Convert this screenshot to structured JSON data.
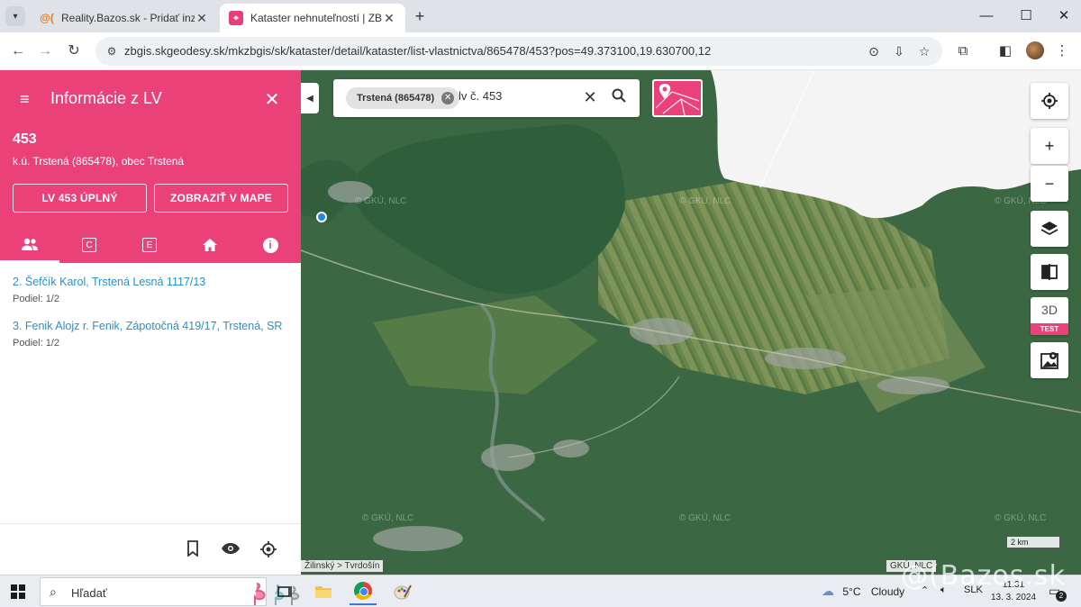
{
  "browser": {
    "tabs": [
      {
        "title": "Reality.Bazos.sk - Pridať inzerát",
        "favicon": "bazos-favicon",
        "active": false
      },
      {
        "title": "Kataster nehnuteľností | ZBGIS",
        "favicon": "zbgis-favicon",
        "active": true
      }
    ],
    "url": "zbgis.skgeodesy.sk/mkzbgis/sk/kataster/detail/kataster/list-vlastnictva/865478/453?pos=49.373100,19.630700,12"
  },
  "panel": {
    "title": "Informácie z LV",
    "lv_number": "453",
    "subtitle": "k.ú. Trstená (865478), obec Trstená",
    "btn_full": "LV 453 ÚPLNÝ",
    "btn_map": "ZOBRAZIŤ V MAPE",
    "tabs": [
      {
        "icon": "people-icon",
        "label": ""
      },
      {
        "icon": "c-box-icon",
        "label": "C"
      },
      {
        "icon": "e-box-icon",
        "label": "E"
      },
      {
        "icon": "home-icon",
        "label": ""
      },
      {
        "icon": "info-icon",
        "label": "i"
      }
    ],
    "owners": [
      {
        "name": "2. Šefčík Karol, Trstená Lesná 1117/13",
        "share": "Podiel: 1/2"
      },
      {
        "name": "3. Fenik Alojz r. Fenik, Zápotočná 419/17, Trstená, SR",
        "share": "Podiel: 1/2"
      }
    ]
  },
  "map": {
    "search_chip": "Trstená (865478)",
    "search_query": "lv č. 453",
    "controls_3d": "3D",
    "controls_test": "TEST",
    "scale": "2 km",
    "breadcrumb": "Žilinský > Tvrdošín",
    "attribution": "GKÚ, NLC",
    "watermark": "© GKÚ, NLC"
  },
  "taskbar": {
    "search_placeholder": "Hľadať",
    "weather_temp": "5°C",
    "weather_desc": "Cloudy",
    "lang": "SLK",
    "time": "11:31",
    "date": "13. 3. 2024",
    "notifications": "2",
    "overlay_watermark": "@(Bazos.sk"
  },
  "colors": {
    "accent": "#ea4179",
    "link": "#2a8fc7"
  }
}
